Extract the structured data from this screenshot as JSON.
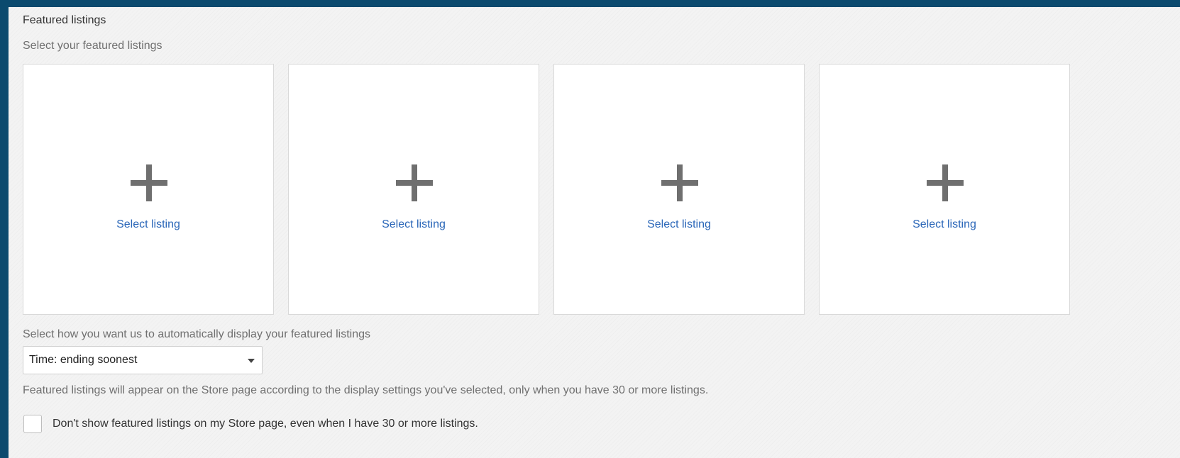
{
  "section": {
    "title": "Featured listings",
    "subtitle": "Select your featured listings"
  },
  "tiles": [
    {
      "icon": "plus-icon",
      "label": "Select listing"
    },
    {
      "icon": "plus-icon",
      "label": "Select listing"
    },
    {
      "icon": "plus-icon",
      "label": "Select listing"
    },
    {
      "icon": "plus-icon",
      "label": "Select listing"
    }
  ],
  "display": {
    "label": "Select how you want us to automatically display your featured listings",
    "selected_option": "Time: ending soonest",
    "caret_icon": "caret-down-icon"
  },
  "info_text": "Featured listings will appear on the Store page according to the display settings you've selected, only when you have 30 or more listings.",
  "opt_out": {
    "checked": false,
    "label": "Don't show featured listings on my Store page, even when I have 30 or more listings."
  },
  "colors": {
    "outer_background": "#0b4a6e",
    "panel_background": "#f3f3f3",
    "link": "#2a66b8",
    "plus_icon": "#6f6f6f"
  }
}
